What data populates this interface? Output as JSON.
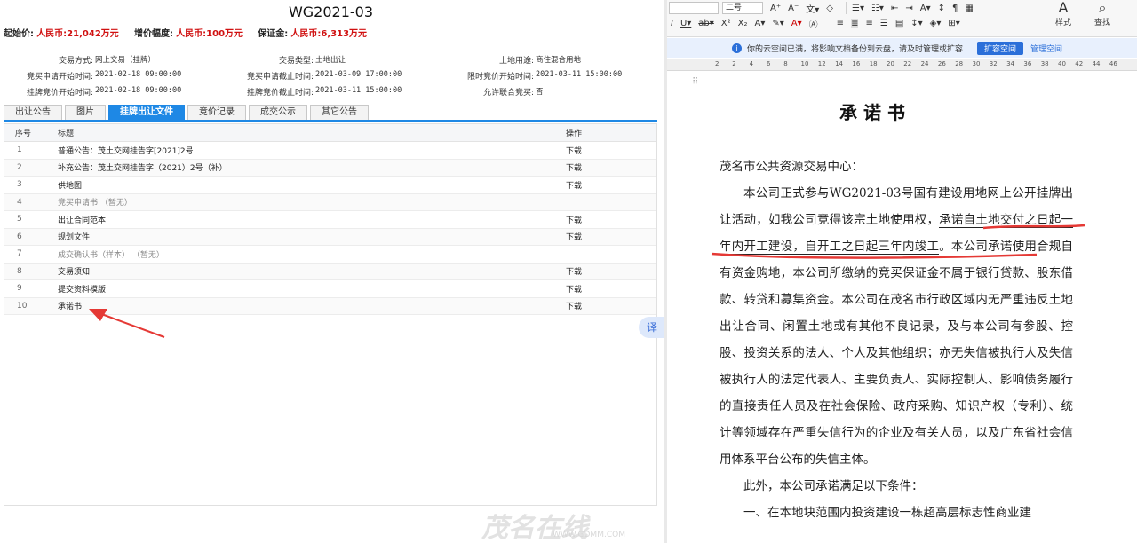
{
  "lot": {
    "code": "WG2021-03",
    "start_price_label": "起始价:",
    "start_price": "人民币:21,042万元",
    "increment_label": "增价幅度:",
    "increment": "人民币:100万元",
    "deposit_label": "保证金:",
    "deposit": "人民币:6,313万元"
  },
  "info": {
    "row1": [
      {
        "k": "交易方式:",
        "v": "网上交易（挂牌）"
      },
      {
        "k": "交易类型:",
        "v": "土地出让"
      },
      {
        "k": "土地用途:",
        "v": "商住混合用地"
      }
    ],
    "row2": [
      {
        "k": "竞买申请开始时间:",
        "v": "2021-02-18 09:00:00"
      },
      {
        "k": "竞买申请截止时间:",
        "v": "2021-03-09 17:00:00"
      },
      {
        "k": "限时竞价开始时间:",
        "v": "2021-03-11 15:00:00"
      }
    ],
    "row3": [
      {
        "k": "挂牌竞价开始时间:",
        "v": "2021-02-18 09:00:00"
      },
      {
        "k": "挂牌竞价截止时间:",
        "v": "2021-03-11 15:00:00"
      },
      {
        "k": "允许联合竞买:",
        "v": "否"
      }
    ]
  },
  "tabs": [
    "出让公告",
    "图片",
    "挂牌出让文件",
    "竞价记录",
    "成交公示",
    "其它公告"
  ],
  "table": {
    "headers": {
      "no": "序号",
      "title": "标题",
      "op": "操作"
    },
    "rows": [
      {
        "no": "1",
        "title": "普通公告：茂土交网挂告字[2021]2号",
        "op": "下载"
      },
      {
        "no": "2",
        "title": "补充公告：茂土交网挂告字（2021）2号（补）",
        "op": "下载"
      },
      {
        "no": "3",
        "title": "供地图",
        "op": "下载"
      },
      {
        "no": "4",
        "title": "竞买申请书    （暂无）",
        "op": ""
      },
      {
        "no": "5",
        "title": "出让合同范本",
        "op": "下载"
      },
      {
        "no": "6",
        "title": "规划文件",
        "op": "下载"
      },
      {
        "no": "7",
        "title": "成交确认书（样本）    （暂无）",
        "op": ""
      },
      {
        "no": "8",
        "title": "交易须知",
        "op": "下载"
      },
      {
        "no": "9",
        "title": "提交资料模版",
        "op": "下载"
      },
      {
        "no": "10",
        "title": "承诺书",
        "op": "下载"
      }
    ]
  },
  "translate_label": "译",
  "ribbon": {
    "font_size": "二号",
    "styles_label": "样式",
    "find_label": "查找"
  },
  "cloud_bar": {
    "message": "你的云空间已满，将影响文档备份到云盘，请及时管理或扩容",
    "expand": "扩容空间",
    "manage": "管理空间"
  },
  "ruler": [
    "2",
    "2",
    "4",
    "6",
    "8",
    "10",
    "12",
    "14",
    "16",
    "18",
    "20",
    "22",
    "24",
    "26",
    "28",
    "30",
    "32",
    "34",
    "36",
    "38",
    "40",
    "42",
    "44",
    "46"
  ],
  "doc": {
    "title": "承诺书",
    "salutation": "茂名市公共资源交易中心：",
    "p1_a": "本公司正式参与WG2021-03号国有建设用地网上公开挂牌出让活动，如我公司竞得该宗土地使用权，",
    "p1_b": "承诺自土地交付之日起",
    "p1_c": "一年",
    "p1_d": "内开工建设，自开工之日起",
    "p1_e": "三年",
    "p1_f": "内竣工",
    "p1_g": "。本公司承诺使用合规自有资金购地，本公司所缴纳的竞买保证金不属于银行贷款、股东借款、转贷和募集资金。本公司在茂名市行政区域内无严重违反土地出让合同、闲置土地或有其他不良记录，及与本公司有参股、控股、投资关系的法人、个人及其他组织；亦无失信被执行人及失信被执行人的法定代表人、主要负责人、实际控制人、影响债务履行的直接责任人员及在社会保险、政府采购、知识产权（专利）、统计等领域存在严重失信行为的企业及有关人员，以及广东省社会信用体系平台公布的失信主体。",
    "p2": "此外，本公司承诺满足以下条件：",
    "p3": "一、在本地块范围内投资建设一栋超高层标志性商业建"
  },
  "watermark": {
    "text": "茂名在线",
    "url": "WWW.GDMM.COM"
  },
  "colors": {
    "accent": "#1e88e5",
    "price_red": "#d01010",
    "annotation_red": "#e53935"
  }
}
